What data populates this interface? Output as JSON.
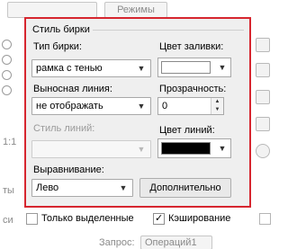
{
  "background": {
    "top_button_label": "Режимы",
    "left_text_ratio": "1:1",
    "left_text_lower": "ты",
    "left_text_bottom": "си",
    "bottom_query_label": "Запрос:",
    "bottom_query_value": "Операций1"
  },
  "label_style": {
    "title": "Стиль бирки",
    "label_type_label": "Тип бирки:",
    "label_type_value": "рамка с тенью",
    "fill_color_label": "Цвет заливки:",
    "fill_color": "#ffffff",
    "leader_line_label": "Выносная линия:",
    "leader_line_value": "не отображать",
    "transparency_label": "Прозрачность:",
    "transparency_value": "0",
    "line_style_label": "Стиль линий:",
    "line_color_label": "Цвет линий:",
    "line_color": "#000000",
    "alignment_label": "Выравнивание:",
    "alignment_value": "Лево",
    "more_button": "Дополнительно"
  },
  "options": {
    "selected_only_label": "Только выделенные",
    "selected_only_checked": false,
    "caching_label": "Кэширование",
    "caching_checked": true
  },
  "colors": {
    "highlight_border": "#d6262f"
  }
}
